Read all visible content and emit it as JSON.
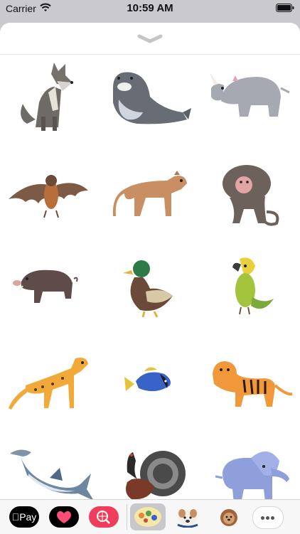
{
  "status_bar": {
    "carrier": "Carrier",
    "time": "10:59 AM"
  },
  "sheet": {
    "handle_icon": "chevron-down-icon"
  },
  "stickers": [
    {
      "name": "wolf"
    },
    {
      "name": "seal"
    },
    {
      "name": "rhino"
    },
    {
      "name": "bat"
    },
    {
      "name": "cougar"
    },
    {
      "name": "baboon"
    },
    {
      "name": "boar"
    },
    {
      "name": "duck"
    },
    {
      "name": "parrot"
    },
    {
      "name": "cheetah"
    },
    {
      "name": "fish"
    },
    {
      "name": "tiger"
    },
    {
      "name": "shark"
    },
    {
      "name": "turkey"
    },
    {
      "name": "elephant"
    }
  ],
  "app_drawer": {
    "apple_pay_label": "Pay",
    "apps": [
      "apple-pay",
      "heart-app",
      "search-app",
      "animal-stickers-app",
      "bulldog-app",
      "puppy-app",
      "more"
    ]
  }
}
